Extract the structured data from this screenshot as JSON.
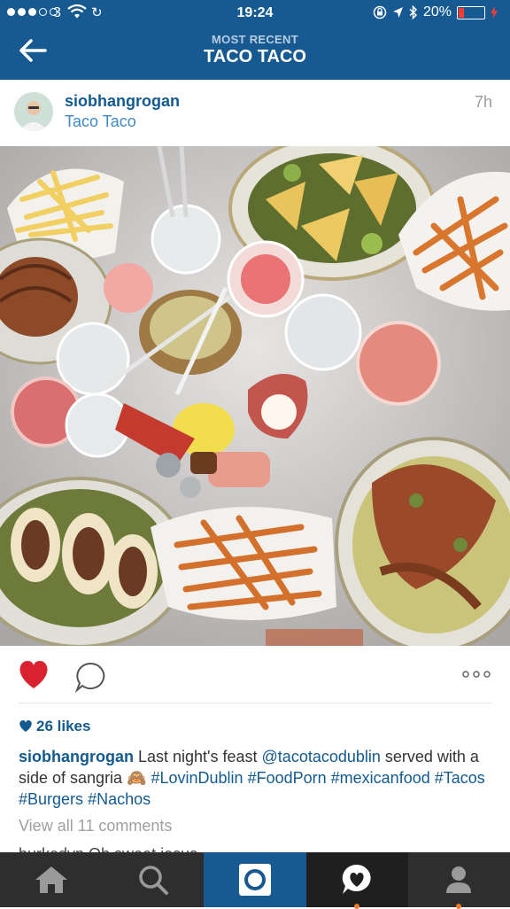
{
  "status_bar": {
    "carrier": "3",
    "time": "19:24",
    "battery": "20%",
    "battery_level": 0.2,
    "icons": [
      "signal-dots-icon",
      "wifi-icon",
      "sync-icon",
      "orientation-lock-icon",
      "location-arrow-icon",
      "bluetooth-icon",
      "battery-icon",
      "charging-bolt-icon"
    ]
  },
  "nav": {
    "subtitle": "MOST RECENT",
    "title": "TACO TACO",
    "back_icon": "back-arrow-icon"
  },
  "post": {
    "username": "siobhangrogan",
    "location": "Taco Taco",
    "age": "7h",
    "likes": "26 likes",
    "caption": {
      "username": "siobhangrogan",
      "text_1": " Last night's feast ",
      "mention": "@tacotacodublin",
      "text_2": " served with a side of sangria 🙈 ",
      "tags": [
        "#LovinDublin",
        "#FoodPorn",
        "#mexicanfood",
        "#Tacos",
        "#Burgers",
        "#Nachos"
      ]
    },
    "view_comments": "View all 11 comments",
    "comment_peek": "burkedvp Oh sweet jesus"
  },
  "colors": {
    "header_blue": "#175a91",
    "link_blue": "#135a8e",
    "location_blue": "#3f8ac6",
    "heart_red": "#d8232f",
    "tabbar": "#2e2e2e",
    "notif_orange": "#f07a2b"
  },
  "tabbar": {
    "tabs": [
      "home-icon",
      "search-icon",
      "camera-icon",
      "activity-heart-icon",
      "profile-icon"
    ],
    "active": "camera-icon"
  }
}
